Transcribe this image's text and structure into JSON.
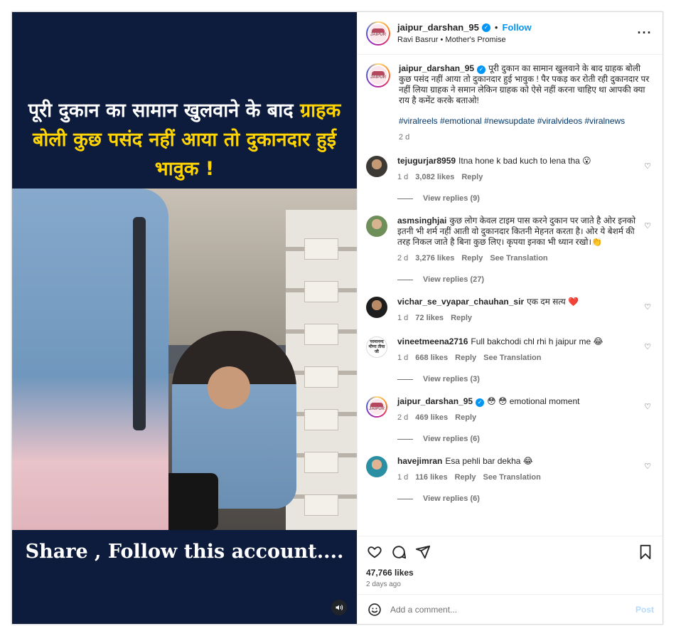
{
  "video": {
    "headline_part1": "पूरी दुकान का सामान खुलवाने के बाद ",
    "headline_highlight": "ग्राहक बोली कुछ पसंद नहीं आया तो दुकानदार हुई भावुक !",
    "footer": "Share , Follow this account...."
  },
  "header": {
    "username": "jaipur_darshan_95",
    "follow": "Follow",
    "audio": "Ravi Basrur • Mother's Promise"
  },
  "caption": {
    "username": "jaipur_darshan_95",
    "text": "पूरी दुकान का सामान खुलवाने के बाद ग्राहक बोली कुछ पसंद नहीं आया तो दुकानदार हुई भावुक ! पैर पकड़ कर रोती रही दुकानदार पर नहीं लिया ग्राहक ने समान लेकिन ग्राहक को ऐसे नहीं करना चाहिए था आपकी क्या राय है कमेंट करके बताओ!",
    "tags": "#viralreels #emotional #newsupdate #viralvideos #viralnews",
    "time": "2 d"
  },
  "logo_word": "JAIPUR",
  "comments": [
    {
      "username": "tejugurjar8959",
      "text": "Itna hone k bad kuch to lena tha 😮",
      "time": "1 d",
      "likes": "3,082 likes",
      "reply": "Reply",
      "translate": "",
      "view_replies": "View replies (9)"
    },
    {
      "username": "asmsinghjai",
      "text": "कुछ लोग केवल टाइम पास करने दुकान पर जाते है ओर इनको इतनी भी शर्म नहीं आती वो दुकानदार कितनी मेहनत करता है। ओर ये बेशर्म की तरह निकल जाते है बिना कुछ लिए। कृपया इनका भी ध्यान रखो।👏",
      "time": "2 d",
      "likes": "3,276 likes",
      "reply": "Reply",
      "translate": "See Translation",
      "view_replies": "View replies (27)"
    },
    {
      "username": "vichar_se_vyapar_chauhan_sir",
      "text": "एक दम सत्य ❤️",
      "time": "1 d",
      "likes": "72 likes",
      "reply": "Reply",
      "translate": "",
      "view_replies": ""
    },
    {
      "username": "vineetmeena2716",
      "text": "Full bakchodi chl rhi h jaipur me 😂",
      "time": "1 d",
      "likes": "668 likes",
      "reply": "Reply",
      "translate": "See Translation",
      "view_replies": "View replies (3)",
      "avatar_text": "परमानन्द मीणा तीया जी"
    },
    {
      "username": "jaipur_darshan_95",
      "text": "😳 😳 emotional moment",
      "time": "2 d",
      "likes": "469 likes",
      "reply": "Reply",
      "translate": "",
      "view_replies": "View replies (6)"
    },
    {
      "username": "havejimran",
      "text": "Esa pehli bar dekha 😂",
      "time": "1 d",
      "likes": "116 likes",
      "reply": "Reply",
      "translate": "See Translation",
      "view_replies": "View replies (6)"
    }
  ],
  "actions": {
    "likes": "47,766 likes",
    "time": "2 days ago"
  },
  "composer": {
    "placeholder": "Add a comment...",
    "post": "Post"
  },
  "icons": {
    "more": "more-options-icon",
    "verified": "verified-badge-icon",
    "like": "heart-icon",
    "comment": "comment-bubble-icon",
    "share": "paper-plane-icon",
    "save": "bookmark-icon",
    "audio": "speaker-icon",
    "emoji": "emoji-icon"
  },
  "colors": {
    "accent": "#0095f6",
    "video_bg": "#0d1b3d",
    "highlight": "#ffd400"
  }
}
